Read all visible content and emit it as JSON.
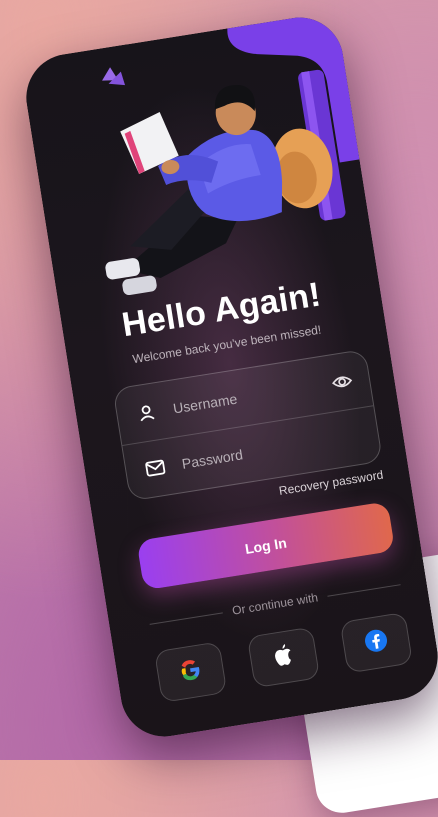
{
  "login": {
    "title": "Hello Again!",
    "subtitle": "Welcome back you've been missed!",
    "username_placeholder": "Username",
    "password_placeholder": "Password",
    "recovery_label": "Recovery password",
    "login_label": "Log In",
    "divider_label": "Or continue with"
  },
  "social": [
    {
      "icon": "google-icon"
    },
    {
      "icon": "apple-icon"
    },
    {
      "icon": "facebook-icon"
    }
  ],
  "colors": {
    "background": "#1a1519",
    "button_gradient_start": "#9a3ff0",
    "button_gradient_end": "#e0684c",
    "accent_purple": "#7a40e8",
    "text_muted": "#bdb3bb"
  }
}
